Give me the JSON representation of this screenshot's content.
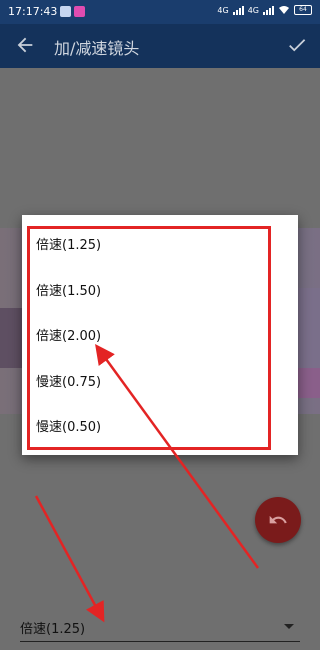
{
  "status_bar": {
    "time": "17:17:43",
    "network_1": "4G",
    "network_2": "4G",
    "battery": "64"
  },
  "app_bar": {
    "title": "加/减速镜头",
    "back_icon": "arrow-left-icon",
    "confirm_icon": "check-icon"
  },
  "speed_dialog": {
    "options": [
      {
        "label": "倍速(1.25)"
      },
      {
        "label": "倍速(1.50)"
      },
      {
        "label": "倍速(2.00)"
      },
      {
        "label": "慢速(0.75)"
      },
      {
        "label": "慢速(0.50)"
      }
    ]
  },
  "speed_select": {
    "value": "倍速(1.25)"
  },
  "fab": {
    "icon": "undo-icon"
  },
  "colors": {
    "status_bar": "#1a3d6d",
    "app_bar": "#1f4e8c",
    "annotation": "#e32424",
    "fab": "#7a1b1b"
  }
}
